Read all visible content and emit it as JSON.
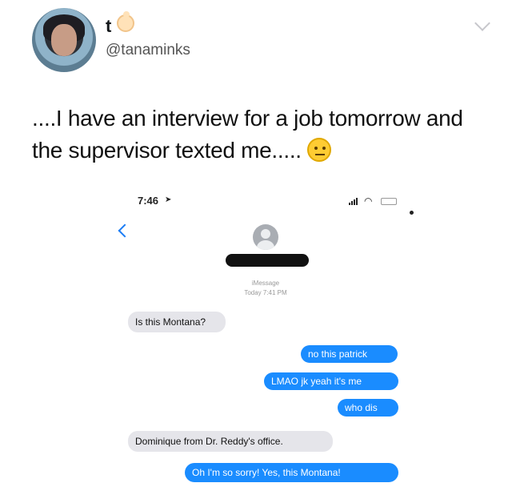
{
  "tweet": {
    "display_name": "t",
    "display_icon": "baby-emoji-icon",
    "handle": "@tanaminks",
    "text": "....I have an interview for a job tomorrow and the supervisor texted me.....",
    "trailing_emoji": "neutral-face-emoji-icon",
    "menu_icon": "chevron-down-icon"
  },
  "phone": {
    "status_time": "7:46",
    "contact_icon": "person-icon",
    "service_label": "iMessage",
    "timestamp": "Today 7:41 PM",
    "messages": [
      {
        "from": "them",
        "text": "Is this Montana?"
      },
      {
        "from": "me",
        "text": "no this patrick"
      },
      {
        "from": "me",
        "text": "LMAO jk yeah it's me"
      },
      {
        "from": "me",
        "text": "who dis"
      },
      {
        "from": "them",
        "text": "Dominique from Dr. Reddy's office."
      },
      {
        "from": "me",
        "text": "Oh I'm so sorry! Yes, this Montana!"
      }
    ]
  },
  "colors": {
    "sent_bubble": "#1a8cff",
    "received_bubble": "#e5e5ea",
    "link_blue": "#1a7cf5"
  }
}
